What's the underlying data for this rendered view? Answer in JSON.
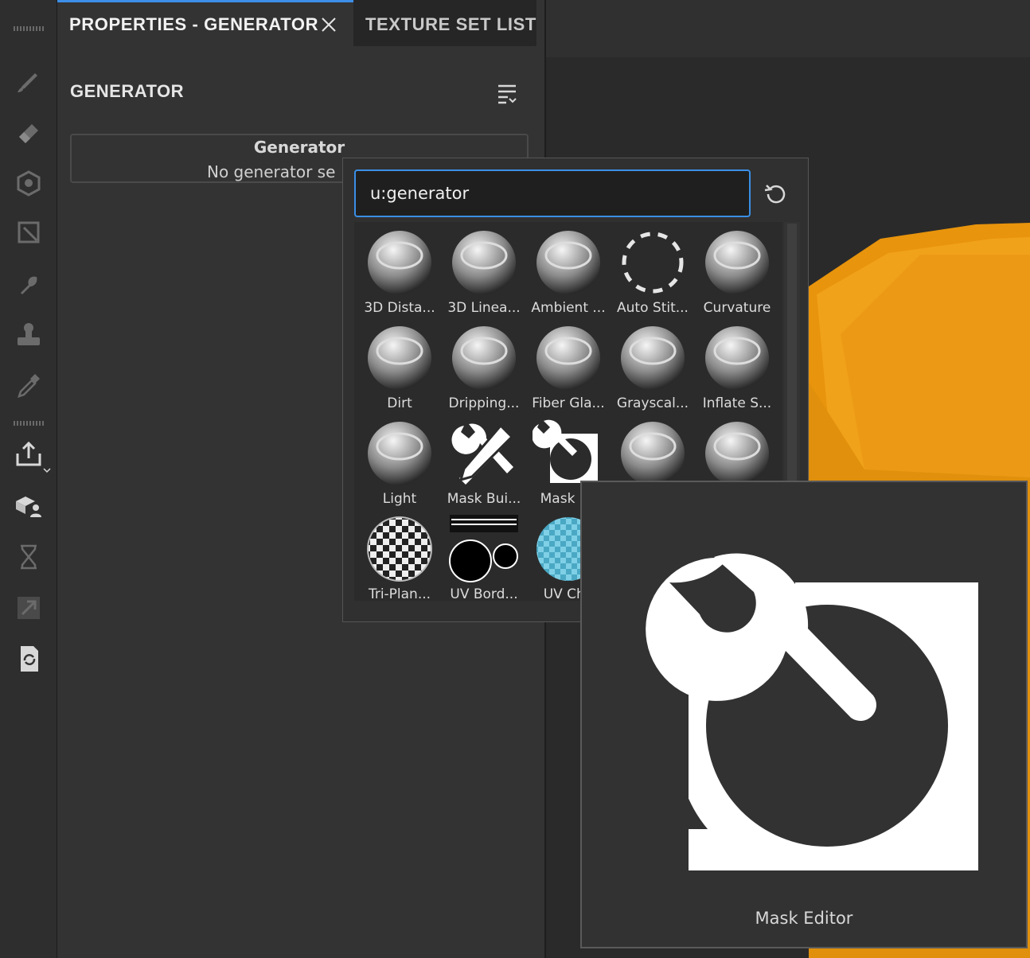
{
  "tabs": {
    "properties": "PROPERTIES - GENERATOR",
    "texture_set_list": "TEXTURE SET LIST"
  },
  "panel": {
    "heading": "GENERATOR",
    "box_title": "Generator",
    "box_subtitle": "No generator se"
  },
  "search": {
    "value": "u:generator"
  },
  "shelf_items": [
    {
      "label": "3D Dista...",
      "icon": "sphere-icon"
    },
    {
      "label": "3D Linea...",
      "icon": "sphere-icon"
    },
    {
      "label": "Ambient ...",
      "icon": "sphere-icon"
    },
    {
      "label": "Auto Stit...",
      "icon": "dashed-circle-icon"
    },
    {
      "label": "Curvature",
      "icon": "sphere-icon"
    },
    {
      "label": "Dirt",
      "icon": "sphere-icon"
    },
    {
      "label": "Dripping...",
      "icon": "sphere-icon"
    },
    {
      "label": "Fiber Gla...",
      "icon": "sphere-icon"
    },
    {
      "label": "Grayscal...",
      "icon": "sphere-icon"
    },
    {
      "label": "Inflate S...",
      "icon": "sphere-icon"
    },
    {
      "label": "Light",
      "icon": "sphere-icon"
    },
    {
      "label": "Mask Bui...",
      "icon": "tools-icon"
    },
    {
      "label": "Mask Ed",
      "icon": "wrench-icon"
    },
    {
      "label": "",
      "icon": "sphere-icon"
    },
    {
      "label": "",
      "icon": "sphere-icon"
    },
    {
      "label": "Tri-Plan...",
      "icon": "checker-sphere-icon"
    },
    {
      "label": "UV Bord...",
      "icon": "uv-border-icon"
    },
    {
      "label": "UV Che",
      "icon": "uv-checker-sphere-icon"
    }
  ],
  "preview": {
    "label": "Mask Editor",
    "icon": "wrench-icon"
  },
  "colors": {
    "accent": "#3d8fe8",
    "viewport_object": "#f0a020"
  }
}
